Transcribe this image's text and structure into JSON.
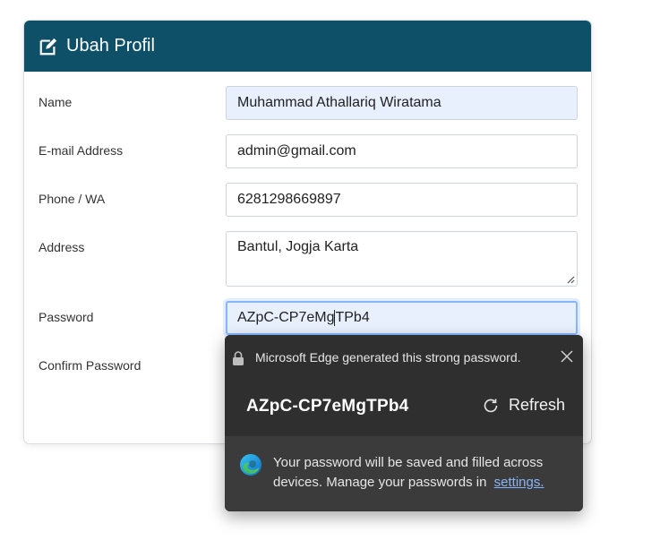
{
  "header": {
    "title": "Ubah Profil",
    "icon": "edit-icon"
  },
  "form": {
    "name_label": "Name",
    "name_value": "Muhammad Athallariq Wiratama",
    "email_label": "E-mail Address",
    "email_value": "admin@gmail.com",
    "phone_label": "Phone / WA",
    "phone_value": "6281298669897",
    "address_label": "Address",
    "address_value": "Bantul, Jogja Karta",
    "password_label": "Password",
    "password_value_before_caret": "AZpC-CP7eMg",
    "password_value_after_caret": "TPb4",
    "confirm_password_label": "Confirm Password"
  },
  "password_popup": {
    "title": "Microsoft Edge generated this strong password.",
    "generated_password": "AZpC-CP7eMgTPb4",
    "refresh_label": "Refresh",
    "message": "Your password will be saved and filled across devices. Manage your passwords in",
    "settings_link": "settings."
  },
  "colors": {
    "header_bg": "#0d5068",
    "autofill_bg": "#e8f0fe",
    "popup_bg": "#2f2f2f",
    "link": "#8ab4f8"
  }
}
